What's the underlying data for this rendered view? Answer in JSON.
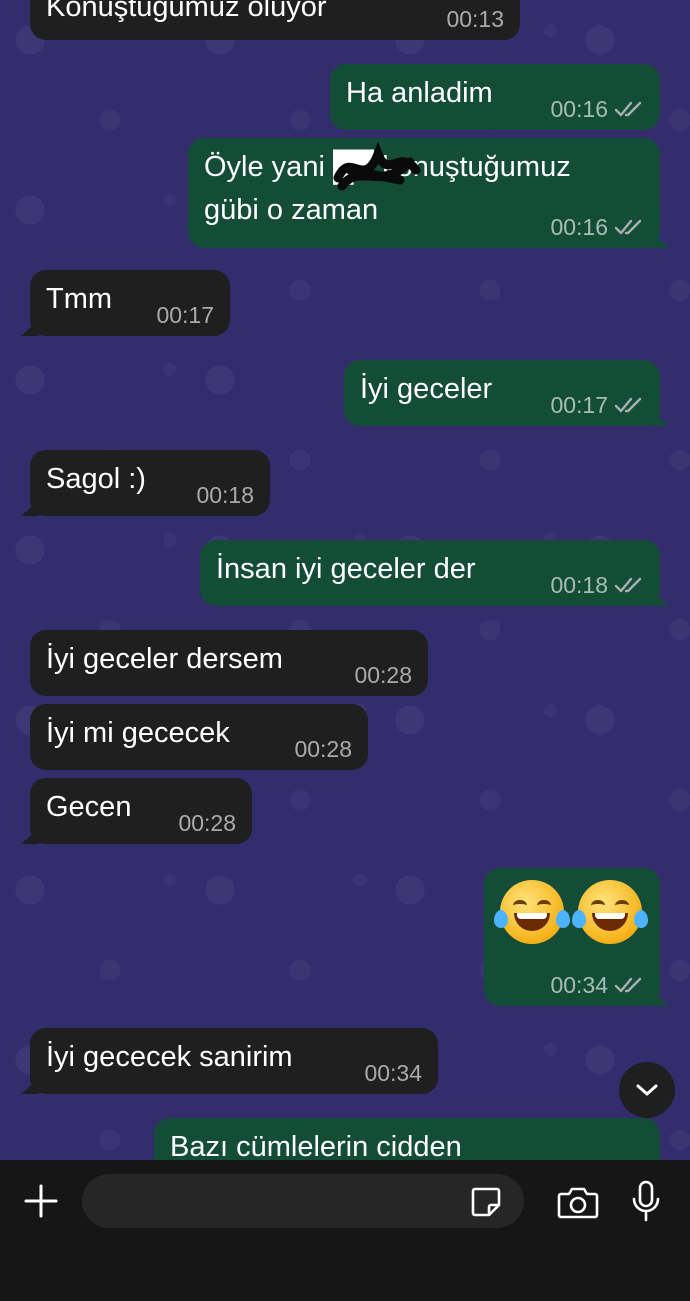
{
  "messages": [
    {
      "id": "m1",
      "direction": "in",
      "text": "Konuştuğumuz oluyor",
      "time": "00:13"
    },
    {
      "id": "m2",
      "direction": "out",
      "text": "Ha anladim",
      "time": "00:16"
    },
    {
      "id": "m3",
      "direction": "out",
      "lines": [
        "Öyle yani █▀ konuştuğumuz",
        "gübi o zaman"
      ],
      "time": "00:16"
    },
    {
      "id": "m4",
      "direction": "in",
      "text": "Tmm",
      "time": "00:17"
    },
    {
      "id": "m5",
      "direction": "out",
      "text": "İyi geceler",
      "time": "00:17"
    },
    {
      "id": "m6",
      "direction": "in",
      "text": "Sagol :)",
      "time": "00:18"
    },
    {
      "id": "m7",
      "direction": "out",
      "text": "İnsan iyi geceler der",
      "time": "00:18"
    },
    {
      "id": "m8",
      "direction": "in",
      "text": "İyi geceler dersem",
      "time": "00:28"
    },
    {
      "id": "m9",
      "direction": "in",
      "text": "İyi mi gececek",
      "time": "00:28"
    },
    {
      "id": "m10",
      "direction": "in",
      "text": "Gecen",
      "time": "00:28"
    },
    {
      "id": "m11",
      "direction": "out",
      "emoji": [
        "face-with-tears-of-joy",
        "face-with-tears-of-joy"
      ],
      "time": "00:34"
    },
    {
      "id": "m12",
      "direction": "in",
      "text": "İyi gececek sanirim",
      "time": "00:34"
    },
    {
      "id": "m13",
      "direction": "out",
      "text": "Bazı cümlelerin cidden",
      "time": ""
    }
  ],
  "input_bar": {
    "plus_icon": "plus-icon",
    "sticker_icon": "sticker-icon",
    "camera_icon": "camera-icon",
    "mic_icon": "microphone-icon",
    "placeholder": ""
  },
  "colors": {
    "wallpaper": "#332d6e",
    "incoming_bubble": "#1f1f1f",
    "outgoing_bubble": "#144d37",
    "read_ticks": "#a8b0b4"
  }
}
